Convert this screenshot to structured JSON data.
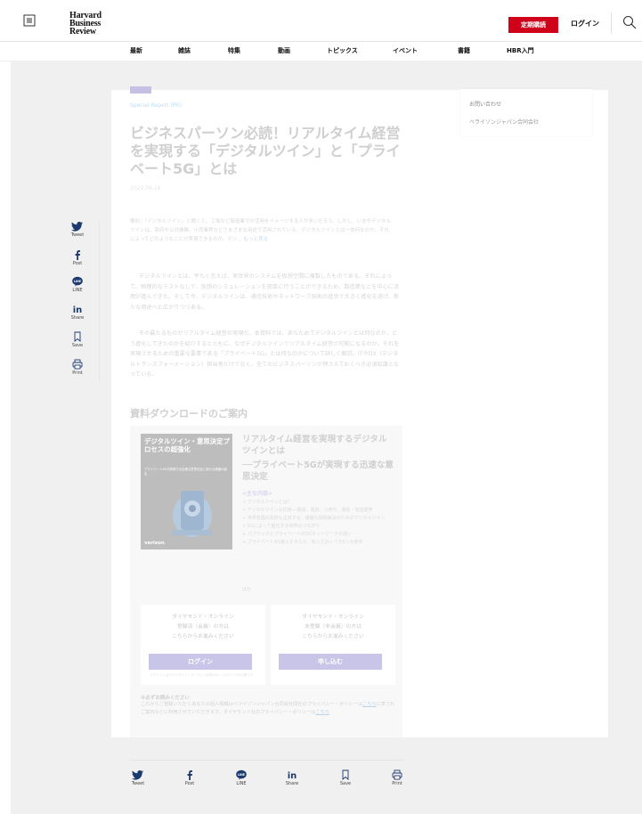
{
  "header": {
    "logo": [
      "Harvard",
      "Business",
      "Review"
    ],
    "subscribe_label": "定期購読",
    "login_label": "ログイン"
  },
  "nav": [
    "最新",
    "雑誌",
    "特集",
    "動画",
    "トピックス",
    "イベント",
    "書籍",
    "HBR入門"
  ],
  "article": {
    "category": "Special Report (PR)",
    "title": "ビジネスパーソン必読！リアルタイム経営を実現する「デジタルツイン」と「プライベート5G」とは",
    "date": "2022.09.16",
    "summary": "要約：「デジタルツイン」と聞くと、工場など製造業での活用をイメージする人が多いだろう。しかし、いまやデジタルツインは、政府や公共機関、小売業界などさまざまな用途で活用されている。デジタルツインとは一体何なのか。それによってどのようなことが実現できるのか。デジ…",
    "summary_more": "もっと見る",
    "body1": "デジタルツインとは、平たく言えば、実世界のシステムを仮想空間に複製したものである。それによって、物理的なテストなしで、仮想のシミュレーションを簡単に行うことができるため、製造業などを中心に活用が進んできた。そして今、デジタルツインは、通信技術やネットワーク技術の進歩で大きく進化を遂げ、新たな用途へと広がりつつある。",
    "body2": "その最たるものがリアルタイム経営の実現だ。本資料では、あらためてデジタルツインとは何なのか、どう進化してきたのかを紹介するとともに、なぜデジタルツインでリアルタイム経営が可能になるのか、それを実現させるための重要な要素である「プライベート5G」とは何なのかについて詳しく解説。ITやDX（デジタルトランスフォーメーション）担当者だけでなく、全てのビジネスパーソンが押さえておくべき必須知識となっている。"
  },
  "side_panel": {
    "contact": "お問い合わせ",
    "company": "ベライゾンジャパン合同会社"
  },
  "download": {
    "heading": "資料ダウンロードのご案内",
    "book_title": "デジタルツイン・意思決定プロセスの超強化",
    "book_subtitle": "プライベート5Gが実現する迅速な意思決定と新たな価値の創出",
    "book_brand": "verizon",
    "title_main": "リアルタイム経営を実現するデジタルツインとは",
    "title_sub": "──プライベート5Gが実現する迅速な意思決定",
    "toc_heading": "<主な内容>",
    "toc": [
      "デジタルツインとは？",
      "デジタルツインの応用──製造、政府、小売り、通信・放送業界",
      "世界各国の政府も注目する、複雑な問題解決のためのデジタルツイン",
      "5Gによって進化する世界のつながり",
      "パブリックとプライベートの5Gネットワークの違い",
      "プライベート5G導入するなら、知っておくべき5つの条件"
    ],
    "toc_more": "ほか",
    "member": {
      "lines": [
        "ダイヤモンド・オンライン",
        "登録済（会員）の方は",
        "こちらからお進みください"
      ],
      "button": "ログイン",
      "note": "ログインにはダイヤモンド・オンライン会員のID・パスワードが必要です。"
    },
    "nonmember": {
      "lines": [
        "ダイヤモンド・オンライン",
        "未登録（非会員）の方は",
        "こちらからお進みください"
      ],
      "button": "申し込む"
    },
    "notice_heading": "※必ずお読みください",
    "notice_a": "これからご登録いただくあなたの個人情報はベライゾンジャパン合同会社同社のプライバシー・ポリシーは",
    "notice_link1": "こちら",
    "notice_b": "に表されご案内などに利用させていただきます。ダイヤモンド社のプライバシー・ポリシーは",
    "notice_link2": "こちら"
  },
  "share": [
    "Tweet",
    "Post",
    "LINE",
    "Share",
    "Save",
    "Print"
  ]
}
